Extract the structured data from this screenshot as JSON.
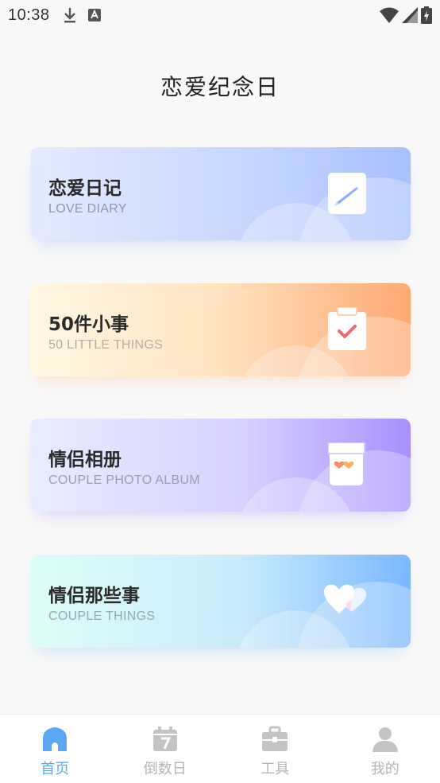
{
  "status_bar": {
    "time": "10:38"
  },
  "page": {
    "title": "恋爱纪念日"
  },
  "cards": [
    {
      "title": "恋爱日记",
      "subtitle": "LOVE DIARY",
      "icon": "diary-note-icon"
    },
    {
      "title": "50件小事",
      "subtitle": "50 LITTLE THINGS",
      "icon": "checklist-clipboard-icon"
    },
    {
      "title": "情侣相册",
      "subtitle": "COUPLE PHOTO ALBUM",
      "icon": "photo-album-icon"
    },
    {
      "title": "情侣那些事",
      "subtitle": "COUPLE THINGS",
      "icon": "double-heart-icon"
    }
  ],
  "bottom_nav": {
    "items": [
      {
        "label": "首页",
        "icon": "home-icon",
        "active": true
      },
      {
        "label": "倒数日",
        "icon": "calendar-icon",
        "active": false
      },
      {
        "label": "工具",
        "icon": "toolbox-icon",
        "active": false
      },
      {
        "label": "我的",
        "icon": "profile-icon",
        "active": false
      }
    ]
  },
  "colors": {
    "active_tab": "#5aa8f3",
    "inactive_tab": "#b5b5b5"
  }
}
